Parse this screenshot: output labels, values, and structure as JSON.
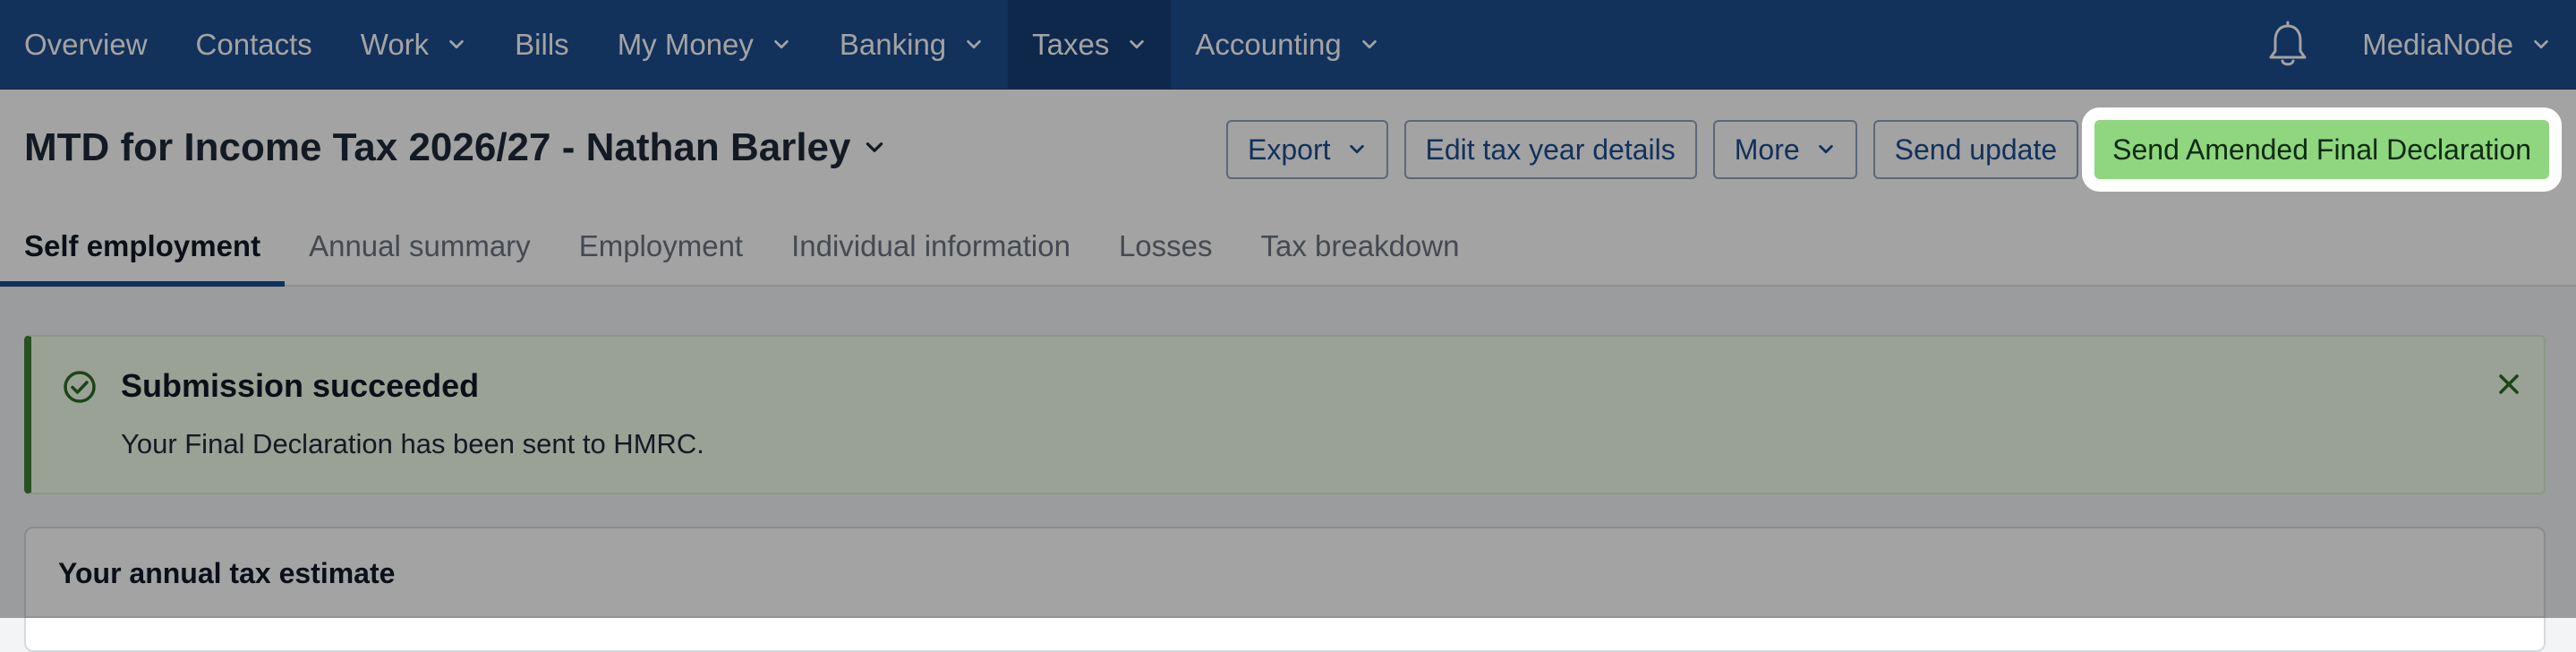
{
  "nav": {
    "items": [
      {
        "label": "Overview",
        "dropdown": false,
        "active": false
      },
      {
        "label": "Contacts",
        "dropdown": false,
        "active": false
      },
      {
        "label": "Work",
        "dropdown": true,
        "active": false
      },
      {
        "label": "Bills",
        "dropdown": false,
        "active": false
      },
      {
        "label": "My Money",
        "dropdown": true,
        "active": false
      },
      {
        "label": "Banking",
        "dropdown": true,
        "active": false
      },
      {
        "label": "Taxes",
        "dropdown": true,
        "active": true
      },
      {
        "label": "Accounting",
        "dropdown": true,
        "active": false
      }
    ],
    "org_name": "MediaNode",
    "bell_icon": "bell-icon"
  },
  "header": {
    "title": "MTD for Income Tax 2026/27 - Nathan Barley",
    "export_label": "Export",
    "edit_label": "Edit tax year details",
    "more_label": "More",
    "send_update_label": "Send update",
    "send_amended_label": "Send Amended Final Declaration"
  },
  "tabs": [
    {
      "label": "Self employment",
      "active": true
    },
    {
      "label": "Annual summary",
      "active": false
    },
    {
      "label": "Employment",
      "active": false
    },
    {
      "label": "Individual information",
      "active": false
    },
    {
      "label": "Losses",
      "active": false
    },
    {
      "label": "Tax breakdown",
      "active": false
    }
  ],
  "alert": {
    "title": "Submission succeeded",
    "message": "Your Final Declaration has been sent to HMRC.",
    "icon": "check-circle-icon",
    "close_icon": "close-icon"
  },
  "card": {
    "heading": "Your annual tax estimate"
  },
  "colors": {
    "nav_bg": "#1d4d8f",
    "primary_button": "#8fd67f",
    "success_border": "#3f7f35"
  }
}
